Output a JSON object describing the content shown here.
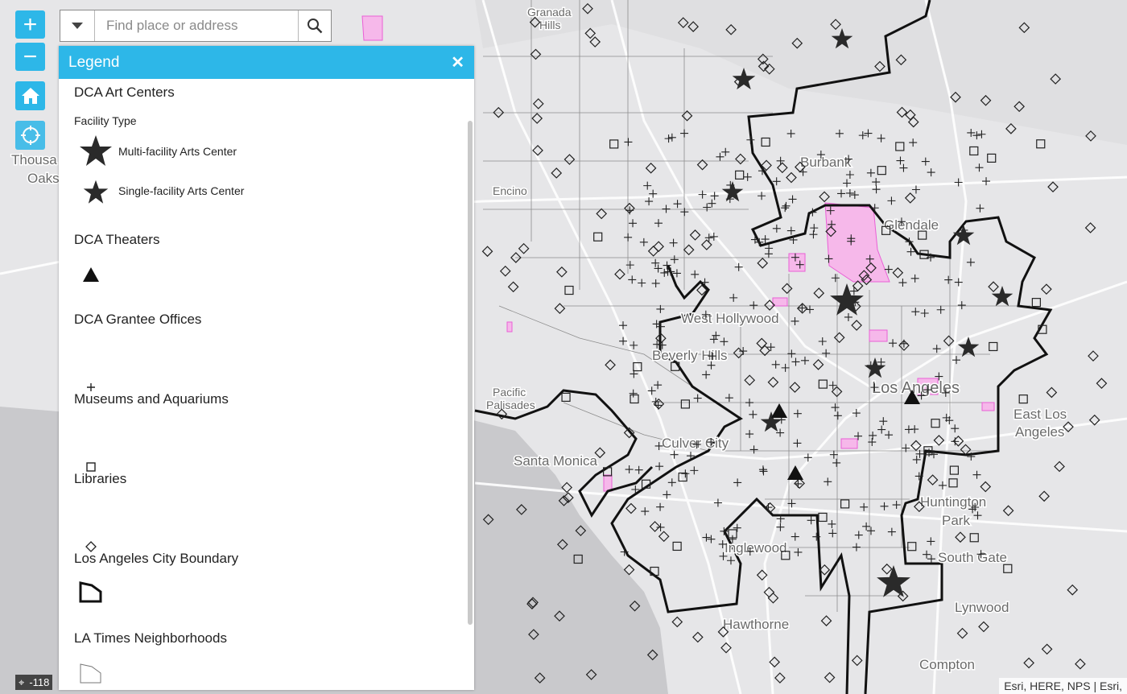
{
  "search": {
    "placeholder": "Find place or address"
  },
  "zoom": {
    "in_label": "+",
    "out_label": "−"
  },
  "legend": {
    "title": "Legend",
    "close_label": "✕",
    "sections": {
      "art_centers": "DCA Art Centers",
      "facility_type": "Facility Type",
      "multi": "Multi-facility Arts Center",
      "single": "Single-facility Arts Center",
      "theaters": "DCA Theaters",
      "grantee": "DCA Grantee Offices",
      "museums": "Museums and Aquariums",
      "libraries": "Libraries",
      "boundary": "Los Angeles City Boundary",
      "neighborhoods": "LA Times Neighborhoods"
    }
  },
  "attribution": "Esri, HERE, NPS | Esri,",
  "scale_label": "-118",
  "map_labels": {
    "granada_1": "Granada",
    "granada_2": "Hills",
    "thousand_1": "Thousa",
    "thousand_2": "Oaks",
    "burbank": "Burbank",
    "glendale": "Glendale",
    "encino": "Encino",
    "west_hollywood": "West Hollywood",
    "beverly_hills": "Beverly Hills",
    "los_angeles": "Los Angeles",
    "pacific_1": "Pacific",
    "pacific_2": "Palisades",
    "santa_monica": "Santa Monica",
    "culver_city": "Culver City",
    "east_la_1": "East Los",
    "east_la_2": "Angeles",
    "huntington_1": "Huntington",
    "huntington_2": "Park",
    "inglewood": "Inglewood",
    "south_gate": "South Gate",
    "lynwood": "Lynwood",
    "hawthorne": "Hawthorne",
    "compton": "Compton"
  },
  "colors": {
    "accent": "#2db7e8",
    "ocean": "#c9c9cc",
    "land": "#e6e6e8",
    "parks": "#f6b8ea",
    "boundary": "#111111"
  },
  "icons": {
    "zoom_in": "plus-icon",
    "zoom_out": "minus-icon",
    "home": "home-icon",
    "locate": "locate-icon",
    "search": "search-icon",
    "dropdown": "caret-down-icon",
    "close": "close-icon"
  }
}
